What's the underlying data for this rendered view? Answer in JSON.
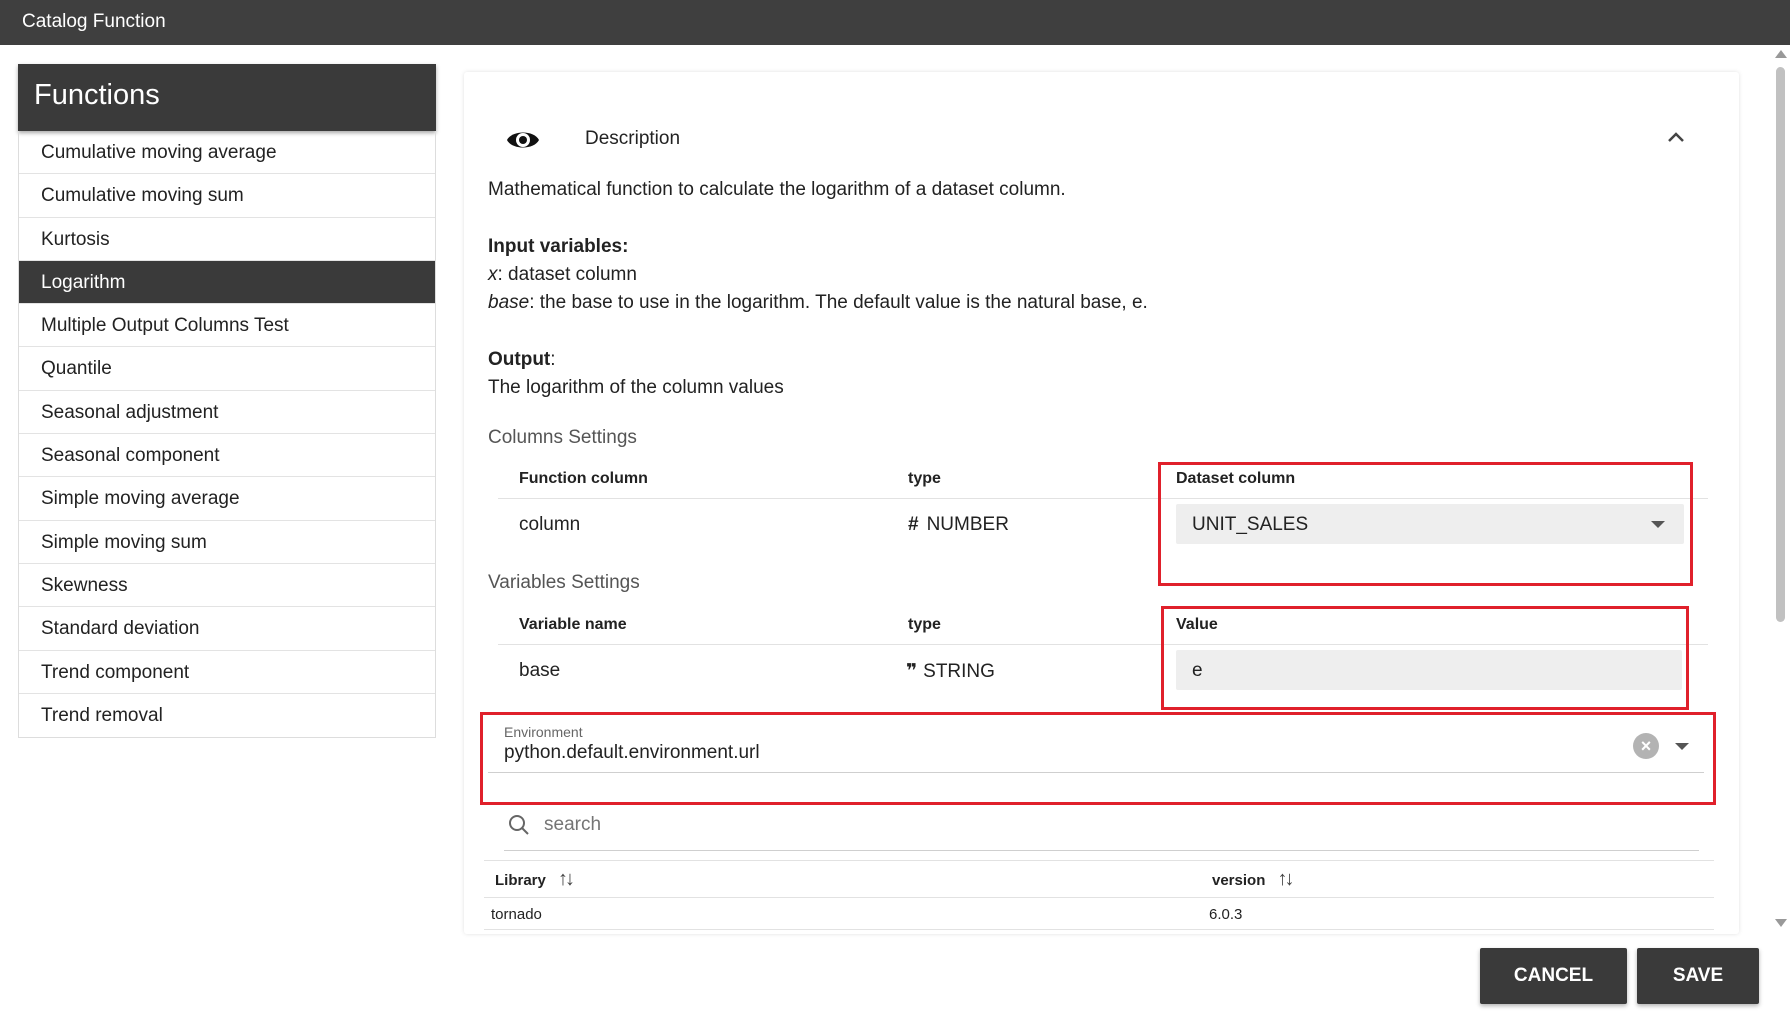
{
  "window": {
    "title": "Catalog Function"
  },
  "sidebar": {
    "title": "Functions",
    "items": [
      {
        "label": "Cumulative moving average"
      },
      {
        "label": "Cumulative moving sum"
      },
      {
        "label": "Kurtosis"
      },
      {
        "label": "Logarithm",
        "selected": true
      },
      {
        "label": "Multiple Output Columns Test"
      },
      {
        "label": "Quantile"
      },
      {
        "label": "Seasonal adjustment"
      },
      {
        "label": "Seasonal component"
      },
      {
        "label": "Simple moving average"
      },
      {
        "label": "Simple moving sum"
      },
      {
        "label": "Skewness"
      },
      {
        "label": "Standard deviation"
      },
      {
        "label": "Trend component"
      },
      {
        "label": "Trend removal"
      }
    ]
  },
  "description": {
    "header_label": "Description",
    "icon": "eye-icon",
    "collapse_icon": "chevron-up-icon",
    "summary": "Mathematical function to calculate the logarithm of a dataset column.",
    "input_variables_heading": "Input variables:",
    "var_x_name": "x",
    "var_x_desc": ": dataset column",
    "var_base_name": "base",
    "var_base_desc": ": the base to use in the logarithm. The default value is the natural base, e.",
    "output_heading": "Output",
    "output_colon": ":",
    "output_desc": "The logarithm of the column values"
  },
  "columns_settings": {
    "title": "Columns Settings",
    "headers": {
      "function_column": "Function column",
      "type": "type",
      "dataset_column": "Dataset column"
    },
    "rows": [
      {
        "function_column": "column",
        "type_icon": "#",
        "type": "NUMBER",
        "dataset_column": "UNIT_SALES"
      }
    ]
  },
  "variables_settings": {
    "title": "Variables Settings",
    "headers": {
      "variable_name": "Variable name",
      "type": "type",
      "value": "Value"
    },
    "rows": [
      {
        "variable_name": "base",
        "type_icon": "❞",
        "type": "STRING",
        "value": "e"
      }
    ]
  },
  "environment": {
    "label": "Environment",
    "value": "python.default.environment.url"
  },
  "search": {
    "placeholder": "search"
  },
  "libraries": {
    "headers": {
      "library": "Library",
      "version": "version"
    },
    "rows": [
      {
        "library": "tornado",
        "version": "6.0.3"
      }
    ]
  },
  "footer": {
    "cancel_label": "CANCEL",
    "save_label": "SAVE"
  },
  "colors": {
    "highlight": "#e0202b",
    "dark": "#3a3a3a",
    "titlebar": "#3f3f3f"
  }
}
